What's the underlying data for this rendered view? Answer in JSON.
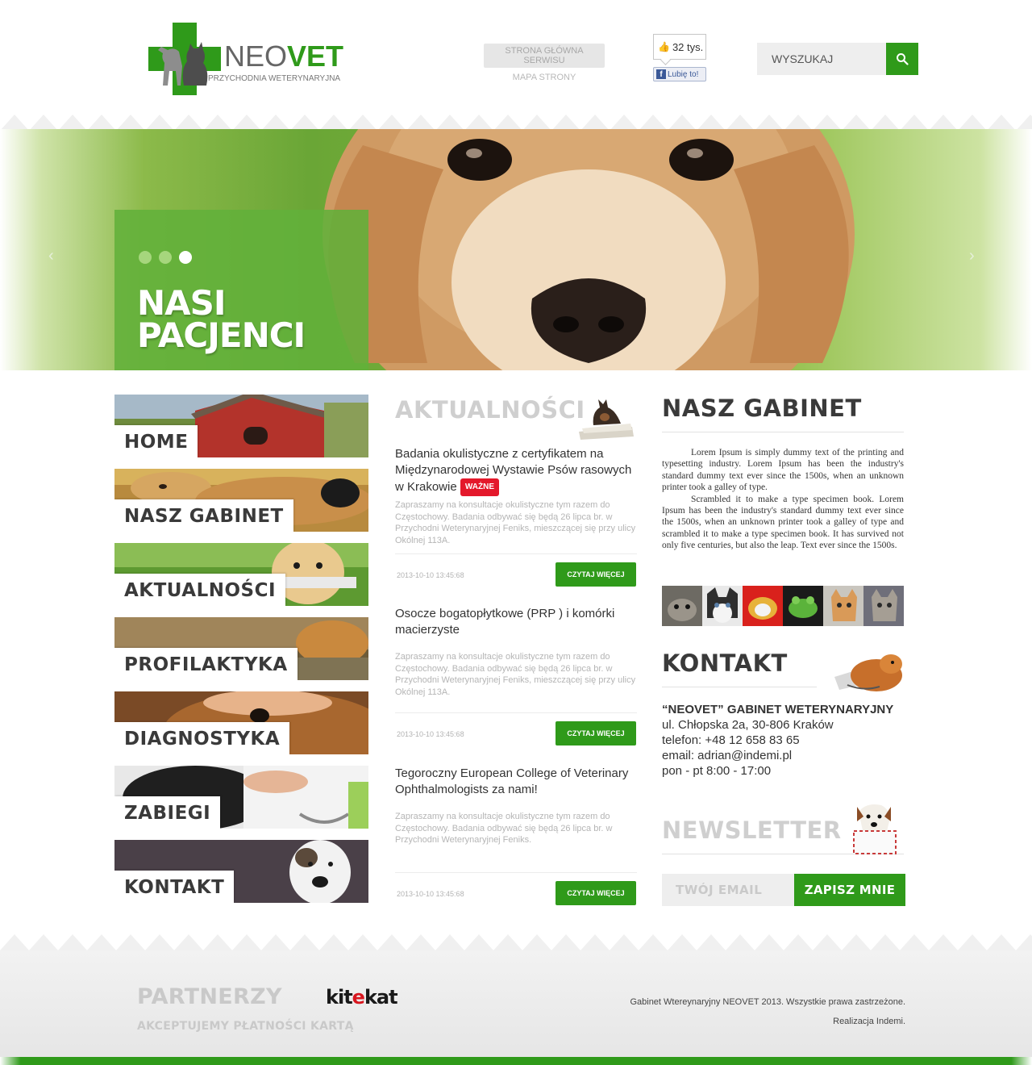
{
  "logo": {
    "brand_neo": "NEO",
    "brand_vet": "VET",
    "subtitle": "PRZYCHODNIA WETERYNARYJNA"
  },
  "header": {
    "link_home": "STRONA GŁÓWNA SERWISU",
    "link_sitemap": "MAPA STRONY",
    "fb_count": "32 tys.",
    "fb_like": "Lubię to!",
    "search_placeholder": "WYSZUKAJ"
  },
  "hero": {
    "headline_line1": "NASI",
    "headline_line2": "PACJENCI",
    "prev": "‹",
    "next": "›",
    "slides_total": 3,
    "active_slide": 3
  },
  "nav": [
    {
      "label": "HOME"
    },
    {
      "label": "NASZ GABINET"
    },
    {
      "label": "AKTUALNOŚCI"
    },
    {
      "label": "PROFILAKTYKA"
    },
    {
      "label": "DIAGNOSTYKA"
    },
    {
      "label": "ZABIEGI"
    },
    {
      "label": "KONTAKT"
    }
  ],
  "news": {
    "title": "AKTUALNOŚCI",
    "items": [
      {
        "title": "Badania okulistyczne z certyfikatem na Międzynarodowej Wystawie Psów rasowych w Krakowie",
        "badge": "WAŻNE",
        "excerpt": "Zapraszamy na konsultacje okulistyczne tym razem do Częstochowy. Badania odbywać się będą 26  lipca br. w Przychodni Weterynaryjnej Feniks, mieszczącej się przy ulicy Okólnej 113A.",
        "date": "2013-10-10 13:45:68",
        "more": "CZYTAJ WIĘCEJ"
      },
      {
        "title": "Osocze bogatopłytkowe (PRP ) i komórki macierzyste",
        "excerpt": "Zapraszamy na konsultacje okulistyczne tym razem do Częstochowy. Badania odbywać się będą 26  lipca br. w Przychodni Weterynaryjnej Feniks, mieszczącej się przy ulicy Okólnej 113A.",
        "date": "2013-10-10 13:45:68",
        "more": "CZYTAJ WIĘCEJ"
      },
      {
        "title": "Tegoroczny European College of Veterinary Ophthalmologists za nami!",
        "excerpt": "Zapraszamy na konsultacje okulistyczne tym razem do Częstochowy. Badania odbywać się będą 26  lipca br. w Przychodni Weterynaryjnej Feniks.",
        "date": "2013-10-10 13:45:68",
        "more": "CZYTAJ WIĘCEJ"
      }
    ]
  },
  "gabinet": {
    "title": "NASZ GABINET",
    "p1": "Lorem Ipsum is simply dummy text of the printing and typesetting industry. Lorem Ipsum has been the industry's standard dummy text ever since the 1500s, when an unknown printer took a galley of type.",
    "p2": "Scrambled it to make a type specimen book. Lorem Ipsum has been the industry's standard dummy text ever since the 1500s, when an unknown printer took a galley of type and scrambled it to make a type specimen book. It has survived not only five centuries, but also the leap. Text ever since the 1500s."
  },
  "kontakt": {
    "title": "KONTAKT",
    "firm": "“NEOVET” GABINET WETERYNARYJNY",
    "address": "ul. Chłopska 2a, 30-806 Kraków",
    "phone": "telefon: +48 12 658 83 65",
    "email": "email: adrian@indemi.pl",
    "hours": "pon - pt 8:00 - 17:00"
  },
  "newsletter": {
    "title": "NEWSLETTER",
    "placeholder": "TWÓJ EMAIL",
    "submit": "ZAPISZ MNIE"
  },
  "footer": {
    "partners": "PARTNERZY",
    "kitekat_1": "kit",
    "kitekat_2": "e",
    "kitekat_3": "kat",
    "cards": "AKCEPTUJEMY PŁATNOŚCI KARTĄ",
    "copyright": "Gabinet Wtereynaryjny NEOVET 2013. Wszystkie prawa zastrzeżone.",
    "credit": "Realizacja Indemi."
  },
  "colors": {
    "brand_green": "#2f9a1a",
    "badge_red": "#e4182b",
    "hero_panel": "#62b03a"
  }
}
